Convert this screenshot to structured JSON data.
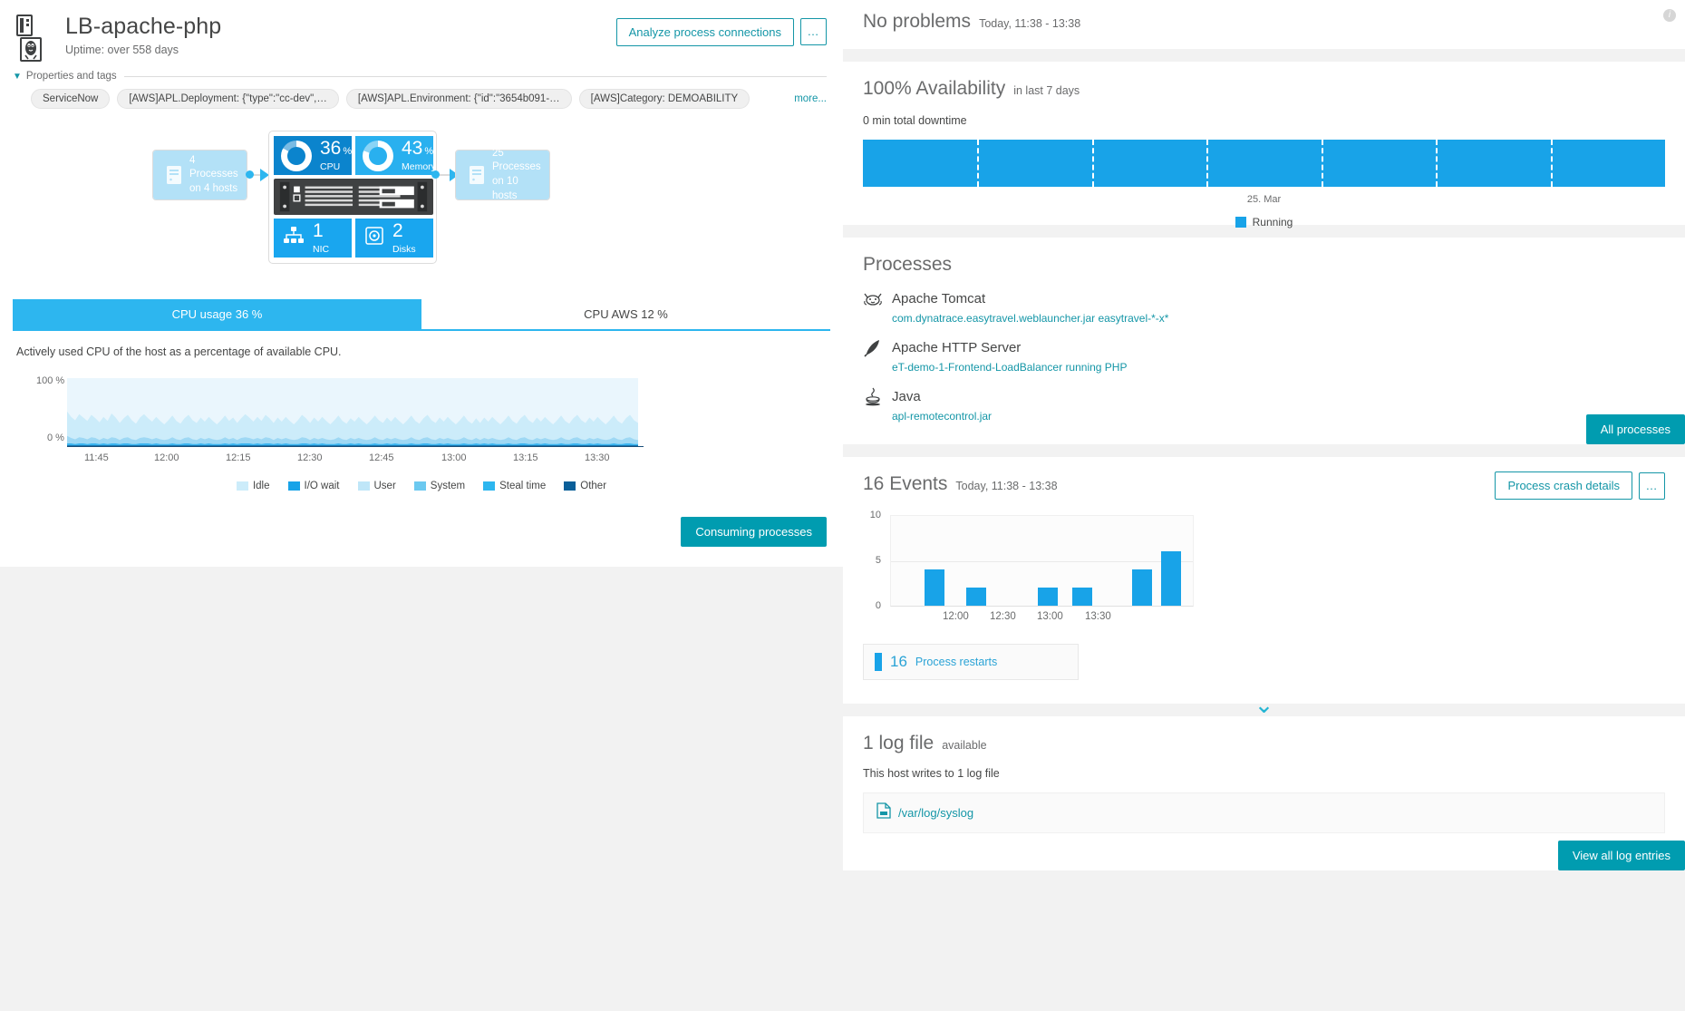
{
  "host": {
    "name": "LB-apache-php",
    "uptime": "Uptime: over 558 days",
    "analyze_button": "Analyze process connections",
    "more_button": "…"
  },
  "properties": {
    "section_label": "Properties and tags",
    "more_link": "more...",
    "tags": [
      "ServiceNow",
      "[AWS]APL.Deployment: {\"type\":\"cc-dev\",…",
      "[AWS]APL.Environment: {\"id\":\"3654b091-…",
      "[AWS]Category: DEMOABILITY"
    ]
  },
  "diagram": {
    "incoming": "4 Processes\non 4 hosts",
    "incoming_line1": "4 Processes",
    "incoming_line2": "on 4 hosts",
    "outgoing_line1": "25 Processes",
    "outgoing_line2": "on 10 hosts",
    "tiles": [
      {
        "value": "36",
        "unit": "%",
        "label": "CPU",
        "color": "#0b84cd",
        "icon": "cpu-donut-icon"
      },
      {
        "value": "43",
        "unit": "%",
        "label": "Memory",
        "color": "#29b0ef",
        "icon": "memory-donut-icon"
      },
      {
        "value": "1",
        "unit": "",
        "label": "NIC",
        "color": "#19a6ef",
        "icon": "network-icon"
      },
      {
        "value": "2",
        "unit": "",
        "label": "Disks",
        "color": "#19a6ef",
        "icon": "disk-icon"
      }
    ]
  },
  "cpu": {
    "tabs": [
      {
        "label": "CPU usage 36 %",
        "active": true
      },
      {
        "label": "CPU AWS 12 %",
        "active": false
      }
    ],
    "description": "Actively used CPU of the host as a percentage of available CPU.",
    "consuming_button": "Consuming processes"
  },
  "problems": {
    "title": "No problems",
    "subtitle": "Today, 11:38 - 13:38"
  },
  "availability": {
    "title": "100% Availability",
    "subtitle": "in last 7 days",
    "downtime": "0 min total downtime",
    "axis_label": "25. Mar",
    "legend": "Running"
  },
  "processes": {
    "title": "Processes",
    "all_button": "All processes",
    "items": [
      {
        "name": "Apache Tomcat",
        "detail": "com.dynatrace.easytravel.weblauncher.jar easytravel-*-x*",
        "icon": "tomcat-icon"
      },
      {
        "name": "Apache HTTP Server",
        "detail": "eT-demo-1-Frontend-LoadBalancer running PHP",
        "icon": "apache-feather-icon"
      },
      {
        "name": "Java",
        "detail": "apl-remotecontrol.jar",
        "icon": "java-icon"
      }
    ]
  },
  "events": {
    "title": "16 Events",
    "subtitle": "Today, 11:38 - 13:38",
    "crash_button": "Process crash details",
    "more_button": "…",
    "restart_count": "16",
    "restart_label": "Process restarts"
  },
  "logs": {
    "title": "1 log file",
    "subtitle": "available",
    "description": "This host writes to 1 log file",
    "path": "/var/log/syslog",
    "view_button": "View all log entries"
  },
  "chart_data": [
    {
      "type": "area",
      "name": "cpu-usage-chart",
      "title": "CPU usage 36 %",
      "xlabel": "",
      "ylabel": "",
      "ylim": [
        0,
        100
      ],
      "ytick_labels": [
        "100 %",
        "0 %"
      ],
      "xtick_labels": [
        "11:45",
        "12:00",
        "12:15",
        "12:30",
        "12:45",
        "13:00",
        "13:15",
        "13:30"
      ],
      "legend": [
        {
          "name": "Idle",
          "color": "#ccecfa"
        },
        {
          "name": "I/O wait",
          "color": "#18a3e8"
        },
        {
          "name": "User",
          "color": "#bfe6f8"
        },
        {
          "name": "System",
          "color": "#6cc9f0"
        },
        {
          "name": "Steal time",
          "color": "#2db6ef"
        },
        {
          "name": "Other",
          "color": "#0a5f99"
        }
      ],
      "series": [
        {
          "name": "Idle",
          "color": "#ccecfa",
          "values": [
            36,
            31,
            28,
            34,
            30,
            27,
            33,
            29,
            26,
            31,
            27,
            35,
            30,
            25,
            29,
            33,
            28,
            24,
            30,
            34,
            29,
            26,
            31,
            27,
            23,
            28,
            32,
            27,
            24,
            29,
            33,
            28,
            25,
            30,
            26,
            31,
            27,
            23,
            28,
            32,
            27,
            30,
            25,
            29,
            34,
            30,
            26,
            31,
            27,
            33,
            29,
            25,
            30,
            26,
            31,
            27,
            23,
            28,
            33,
            29,
            25,
            30,
            26,
            31,
            27,
            23,
            28,
            32,
            27,
            24,
            29,
            26,
            31,
            27,
            23,
            28,
            32,
            28,
            25,
            30,
            26,
            31,
            27,
            23,
            28,
            32,
            27,
            24,
            29,
            33,
            28,
            25,
            30,
            26,
            31,
            27,
            23,
            28,
            32,
            27,
            24,
            29,
            25,
            30,
            26,
            31,
            27,
            23,
            28,
            32,
            27,
            24,
            29,
            33,
            28,
            25,
            30,
            26,
            31,
            27,
            23,
            28,
            32,
            27,
            24,
            29,
            33,
            28,
            25,
            30,
            26,
            31,
            27,
            23,
            28,
            32,
            27,
            24,
            29,
            33,
            28,
            25
          ]
        },
        {
          "name": "User",
          "color": "#9ed8f4",
          "values": [
            11,
            8,
            7,
            9,
            8,
            7,
            9,
            8,
            6,
            8,
            7,
            9,
            8,
            6,
            8,
            9,
            7,
            6,
            8,
            9,
            8,
            7,
            8,
            7,
            6,
            7,
            9,
            7,
            6,
            8,
            9,
            7,
            6,
            8,
            7,
            8,
            7,
            6,
            7,
            9,
            7,
            8,
            6,
            8,
            9,
            8,
            7,
            8,
            7,
            9,
            8,
            6,
            8,
            7,
            8,
            7,
            6,
            7,
            9,
            8,
            6,
            8,
            7,
            8,
            7,
            6,
            7,
            9,
            7,
            6,
            8,
            7,
            8,
            7,
            6,
            7,
            9,
            7,
            6,
            8,
            7,
            8,
            7,
            6,
            7,
            9,
            7,
            6,
            8,
            9,
            7,
            6,
            8,
            7,
            8,
            7,
            6,
            7,
            9,
            7,
            6,
            8,
            6,
            8,
            7,
            8,
            7,
            6,
            7,
            9,
            7,
            6,
            8,
            9,
            7,
            6,
            8,
            7,
            8,
            7,
            6,
            7,
            9,
            7,
            6,
            8,
            9,
            7,
            6,
            8,
            7,
            8,
            7,
            6,
            7,
            9,
            7,
            6,
            8,
            9,
            7,
            6
          ]
        },
        {
          "name": "System",
          "color": "#3ab4ef",
          "values": [
            3,
            3,
            2,
            3,
            3,
            2,
            3,
            3,
            2,
            3,
            2,
            3,
            3,
            2,
            3,
            3,
            2,
            2,
            3,
            3,
            3,
            2,
            3,
            2,
            2,
            2,
            3,
            2,
            2,
            3,
            3,
            2,
            2,
            3,
            2,
            3,
            2,
            2,
            2,
            3,
            2,
            3,
            2,
            3,
            3,
            3,
            2,
            3,
            2,
            3,
            3,
            2,
            3,
            2,
            3,
            2,
            2,
            2,
            3,
            3,
            2,
            3,
            2,
            3,
            2,
            2,
            2,
            3,
            2,
            2,
            3,
            2,
            3,
            2,
            2,
            2,
            3,
            2,
            2,
            3,
            2,
            3,
            2,
            2,
            2,
            3,
            2,
            2,
            3,
            3,
            2,
            2,
            3,
            2,
            3,
            2,
            2,
            2,
            3,
            2,
            2,
            3,
            2,
            3,
            2,
            3,
            2,
            2,
            2,
            3,
            2,
            2,
            3,
            3,
            2,
            2,
            3,
            2,
            3,
            2,
            2,
            2,
            3,
            2,
            2,
            3,
            3,
            2,
            2,
            3,
            2,
            3,
            2,
            2,
            2,
            3,
            2,
            2,
            3,
            3,
            2,
            2
          ]
        },
        {
          "name": "Other",
          "color": "#0a5f99",
          "values": [
            1,
            1,
            1,
            1,
            1,
            1,
            1,
            1,
            1,
            1,
            1,
            1,
            1,
            1,
            1,
            1,
            1,
            1,
            1,
            1,
            1,
            1,
            1,
            1,
            1,
            1,
            1,
            1,
            1,
            1,
            1,
            1,
            1,
            1,
            1,
            1,
            1,
            1,
            1,
            1,
            1,
            1,
            1,
            1,
            1,
            1,
            1,
            1,
            1,
            1,
            1,
            1,
            1,
            1,
            1,
            1,
            1,
            1,
            1,
            1,
            1,
            1,
            1,
            1,
            1,
            1,
            1,
            1,
            1,
            1,
            1,
            1,
            1,
            1,
            1,
            1,
            1,
            1,
            1,
            1,
            1,
            1,
            1,
            1,
            1,
            1,
            1,
            1,
            1,
            1,
            1,
            1,
            1,
            1,
            1,
            1,
            1,
            1,
            1,
            1,
            1,
            1,
            1,
            1,
            1,
            1,
            1,
            1,
            1,
            1,
            1,
            1,
            1,
            1,
            1,
            1,
            1,
            1,
            1,
            1,
            1,
            1,
            1,
            1,
            1,
            1,
            1,
            1,
            1,
            1,
            1,
            1,
            1,
            1,
            1,
            1,
            1,
            1,
            1,
            1,
            1,
            1
          ]
        }
      ]
    },
    {
      "type": "bar",
      "name": "events-bar-chart",
      "title": "16 Events",
      "ylim": [
        0,
        10
      ],
      "ytick_labels": [
        "10",
        "5",
        "0"
      ],
      "xtick_labels": [
        "12:00",
        "12:30",
        "13:00",
        "13:30"
      ],
      "bar_color": "#18a3e8",
      "bars": [
        {
          "x_frac": 0.11,
          "value": 4
        },
        {
          "x_frac": 0.25,
          "value": 2
        },
        {
          "x_frac": 0.485,
          "value": 2
        },
        {
          "x_frac": 0.6,
          "value": 2
        },
        {
          "x_frac": 0.8,
          "value": 4
        },
        {
          "x_frac": 0.895,
          "value": 6
        }
      ]
    },
    {
      "type": "bar",
      "name": "availability-bar",
      "title": "100% Availability",
      "segments": 7,
      "value": 100,
      "color": "#18a3e8"
    }
  ]
}
